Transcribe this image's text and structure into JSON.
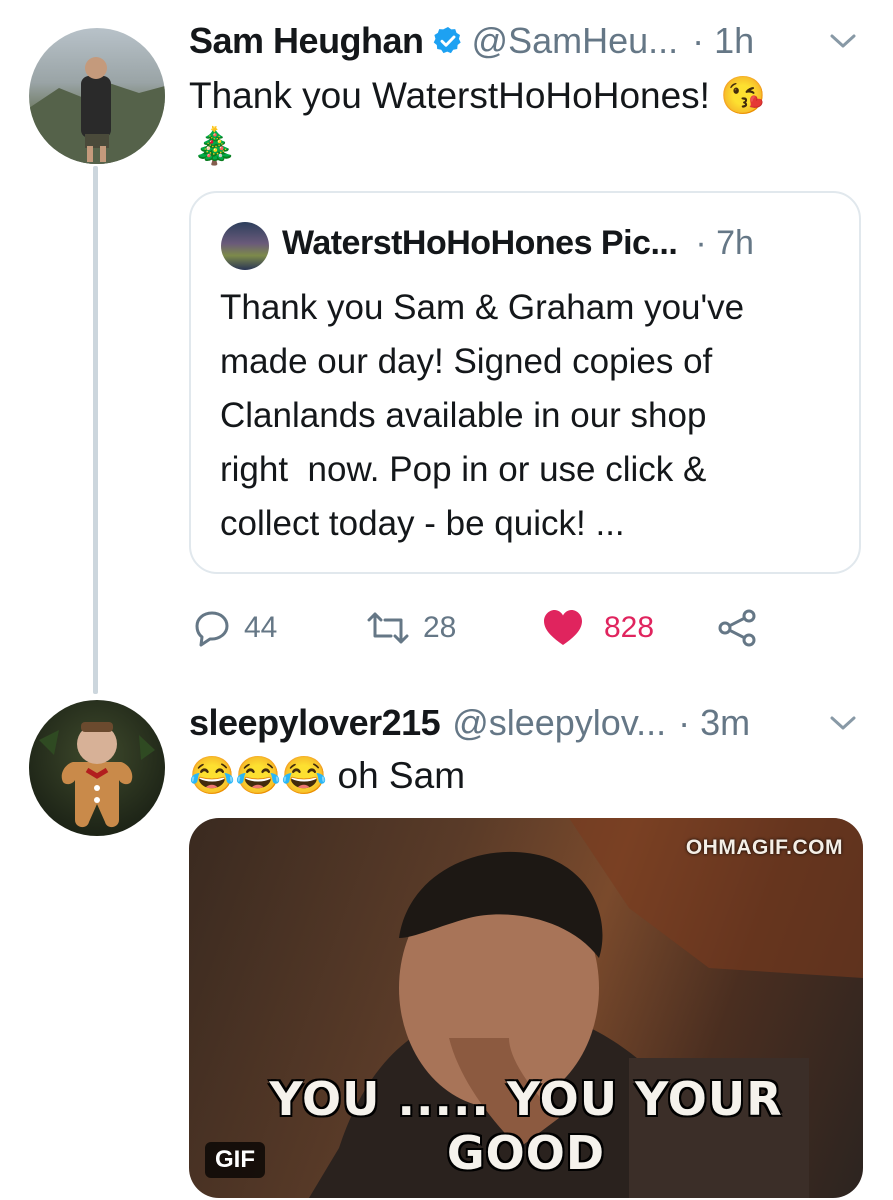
{
  "colors": {
    "accent": "#1da1f2",
    "like": "#e0245e",
    "muted": "#657786",
    "border": "#e1e8ed"
  },
  "tweet1": {
    "name": "Sam Heughan",
    "verified": true,
    "handle": "@SamHeu...",
    "time": "· 1h",
    "text": "Thank you WaterstHoHoHones!",
    "emoji_kiss": "😘",
    "emoji_tree": "🎄",
    "quote": {
      "name": "WaterstHoHoHones Pic...",
      "time": "· 7h",
      "lines": [
        "Thank you Sam & Graham you've",
        "made our day! Signed copies of",
        "Clanlands available in our shop",
        "right  now. Pop in or use click &",
        "collect today - be quick! ..."
      ]
    },
    "actions": {
      "replies": "44",
      "retweets": "28",
      "likes": "828"
    }
  },
  "tweet2": {
    "name": "sleepylover215",
    "handle": "@sleepylov...",
    "time": "· 3m",
    "emoji_laugh": "😂😂😂",
    "text": "oh Sam",
    "gif": {
      "watermark": "OHMAGIF.COM",
      "caption": "YOU ..... YOU YOUR GOOD",
      "badge": "GIF"
    }
  }
}
